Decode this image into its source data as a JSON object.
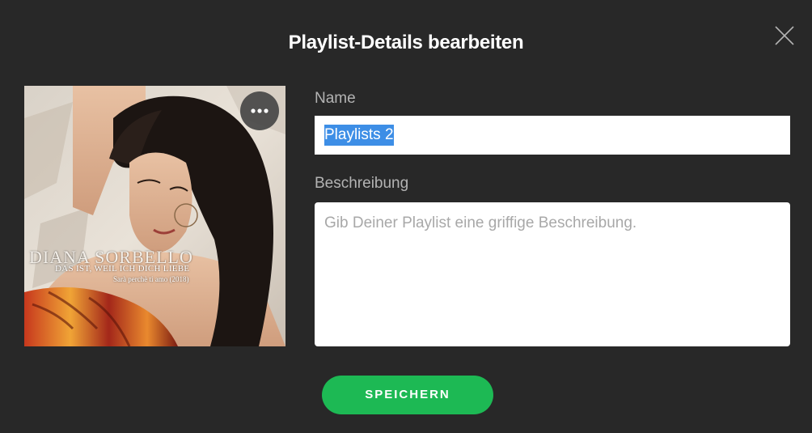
{
  "dialog": {
    "title": "Playlist-Details bearbeiten",
    "close_icon": "close-icon"
  },
  "cover": {
    "artist_text": "DIANA SORBELLO",
    "subtitle_text": "DAS IST, WEIL ICH DICH LIEBE",
    "subtitle2_text": "Sarà perchè ti amo (2018)",
    "more_icon": "more-options-icon"
  },
  "form": {
    "name_label": "Name",
    "name_value": "Playlists 2",
    "description_label": "Beschreibung",
    "description_placeholder": "Gib Deiner Playlist eine griffige Beschreibung."
  },
  "actions": {
    "save_label": "SPEICHERN"
  },
  "colors": {
    "background": "#282828",
    "accent": "#1db954",
    "selection": "#3d8ee6"
  }
}
